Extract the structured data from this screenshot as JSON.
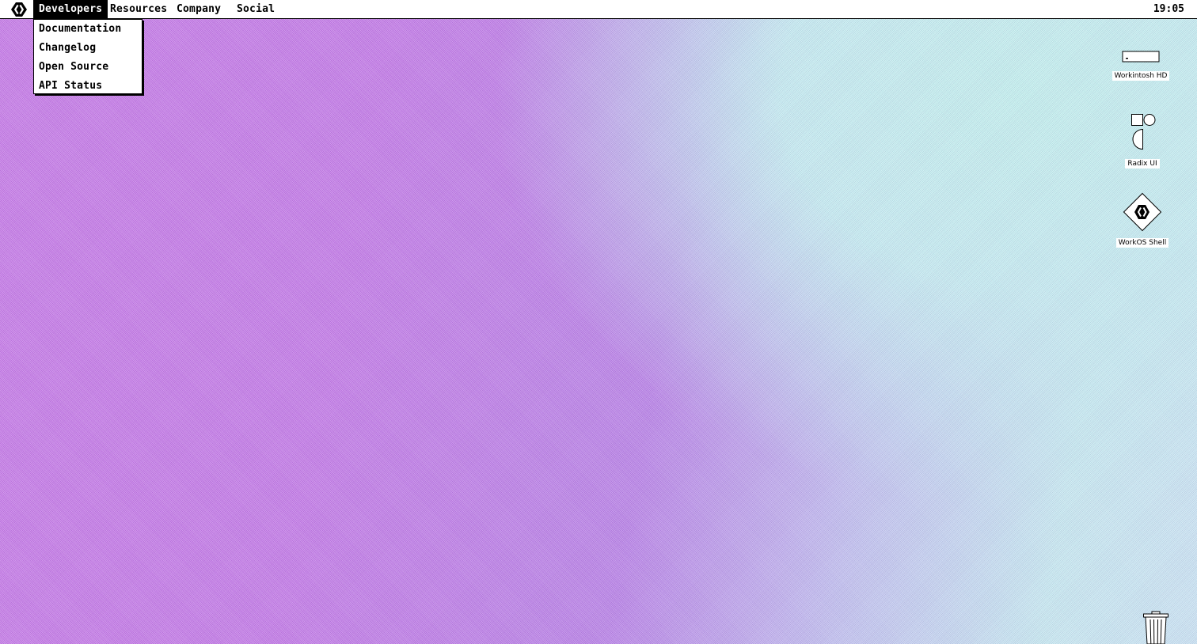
{
  "menubar": {
    "logo_icon": "workos-logo-icon",
    "items": [
      {
        "label": "Developers",
        "active": true
      },
      {
        "label": "Resources",
        "active": false
      },
      {
        "label": "Company",
        "active": false
      },
      {
        "label": "Social",
        "active": false
      }
    ],
    "clock": "19:05"
  },
  "dropdown": {
    "items": [
      {
        "label": "Documentation"
      },
      {
        "label": "Changelog"
      },
      {
        "label": "Open Source"
      },
      {
        "label": "API Status"
      }
    ]
  },
  "desktop": {
    "icons": [
      {
        "label": "Workintosh HD",
        "icon": "hard-drive-icon"
      },
      {
        "label": "Radix UI",
        "icon": "radix-ui-icon"
      },
      {
        "label": "WorkOS Shell",
        "icon": "workos-shell-icon"
      }
    ],
    "trash_icon": "trash-icon"
  },
  "colors": {
    "menubar_bg": "#ffffff",
    "text": "#000000",
    "desktop_left": "#c77ee8",
    "desktop_right": "#c6eef2"
  }
}
